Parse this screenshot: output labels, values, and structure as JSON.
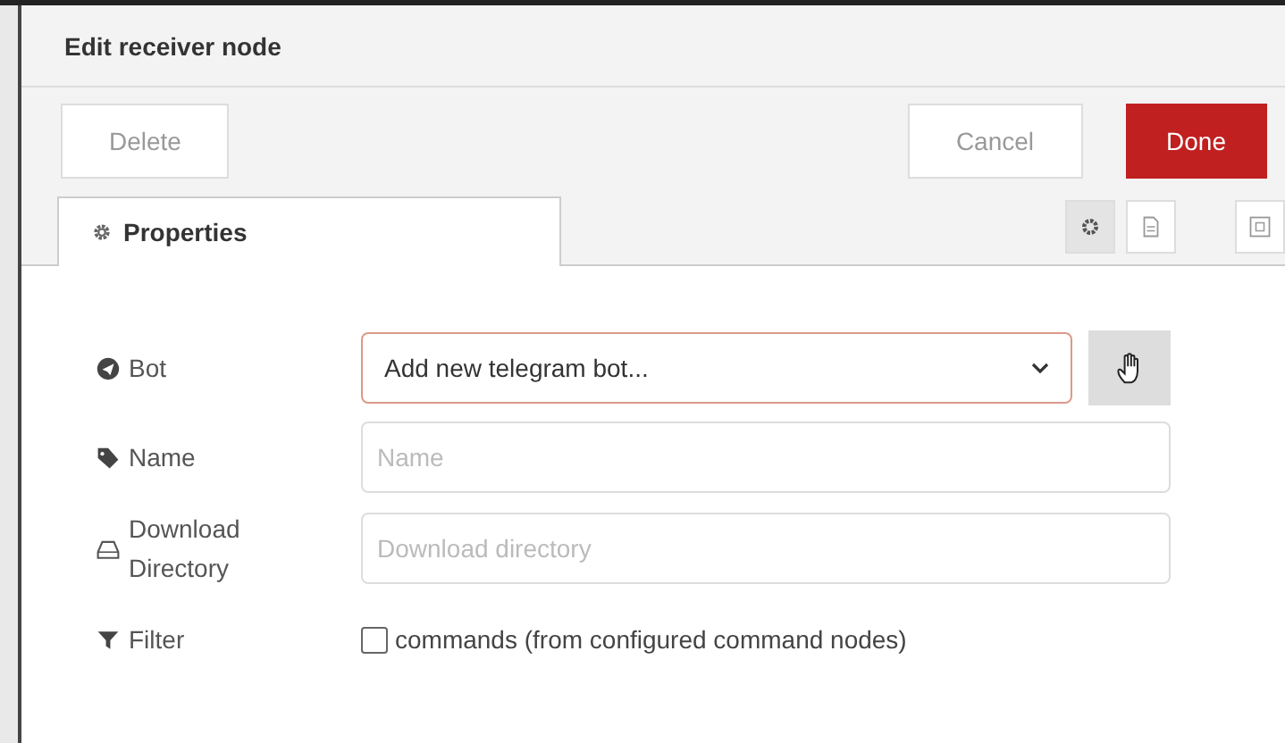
{
  "window": {
    "title": "Edit receiver node"
  },
  "buttons": {
    "delete": "Delete",
    "cancel": "Cancel",
    "done": "Done"
  },
  "tabs": [
    {
      "label": "Properties",
      "selected": true
    }
  ],
  "tab_tools": [
    {
      "kind": "gear",
      "selected": true
    },
    {
      "kind": "doc",
      "selected": false
    },
    {
      "kind": "frame",
      "selected": false
    }
  ],
  "form": [
    {
      "kind": "select",
      "label": "Bot",
      "value": "Add new telegram bot...",
      "invalid": true
    },
    {
      "kind": "input",
      "label": "Name",
      "placeholder": "Name"
    },
    {
      "kind": "input",
      "label": "Download Directory",
      "placeholder": "Download directory"
    },
    {
      "kind": "checkbox",
      "label": "Filter",
      "text": "commands (from configured command nodes)",
      "checked": false
    }
  ]
}
